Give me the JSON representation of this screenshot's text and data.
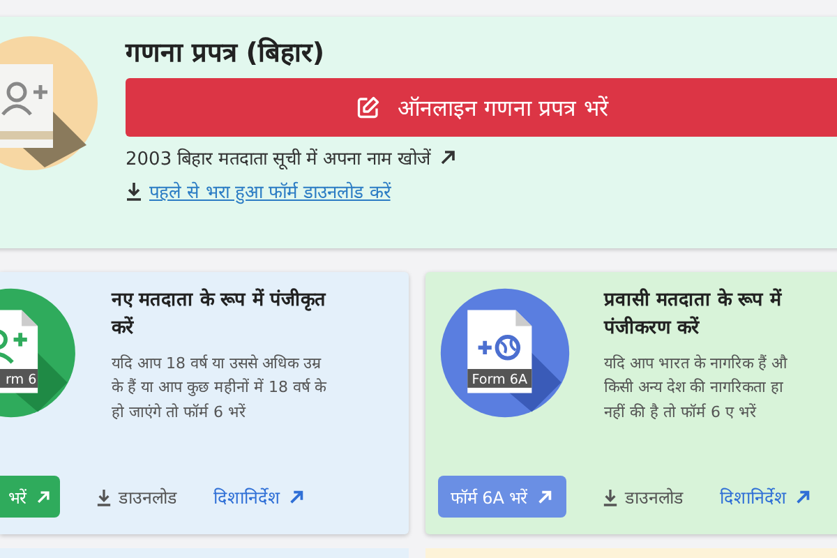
{
  "top_card": {
    "title": "गणना प्रपत्र (बिहार)",
    "fill_button": "ऑनलाइन गणना प्रपत्र भरें",
    "search_link": "2003 बिहार मतदाता सूची में अपना नाम खोजें",
    "download_link": "पहले से भरा हुआ फॉर्म डाउनलोड करें"
  },
  "form_cards": [
    {
      "kind": "register",
      "icon_label": "rm 6",
      "title_lines": [
        "नए मतदाता के रूप में पंजीकृत",
        "करें"
      ],
      "description_lines": [
        "यदि आप 18 वर्ष या उससे अधिक उम्र",
        "के हैं या आप कुछ महीनों में 18 वर्ष के",
        "हो जाएंगे तो फॉर्म 6 भरें"
      ],
      "fill_button": "भरें",
      "download": "डाउनलोड",
      "guidelines": "दिशानिर्देश"
    },
    {
      "kind": "overseas",
      "icon_label": "Form 6A",
      "title_lines": [
        "प्रवासी मतदाता के रूप में",
        "पंजीकरण करें"
      ],
      "description_lines": [
        "यदि आप भारत के नागरिक हैं औ",
        "किसी अन्य देश की नागरिकता हा",
        "नहीं की है तो फॉर्म 6 ए भरें"
      ],
      "fill_button": "फॉर्म 6A भरें",
      "download": "डाउनलोड",
      "guidelines": "दिशानिर्देश"
    }
  ]
}
